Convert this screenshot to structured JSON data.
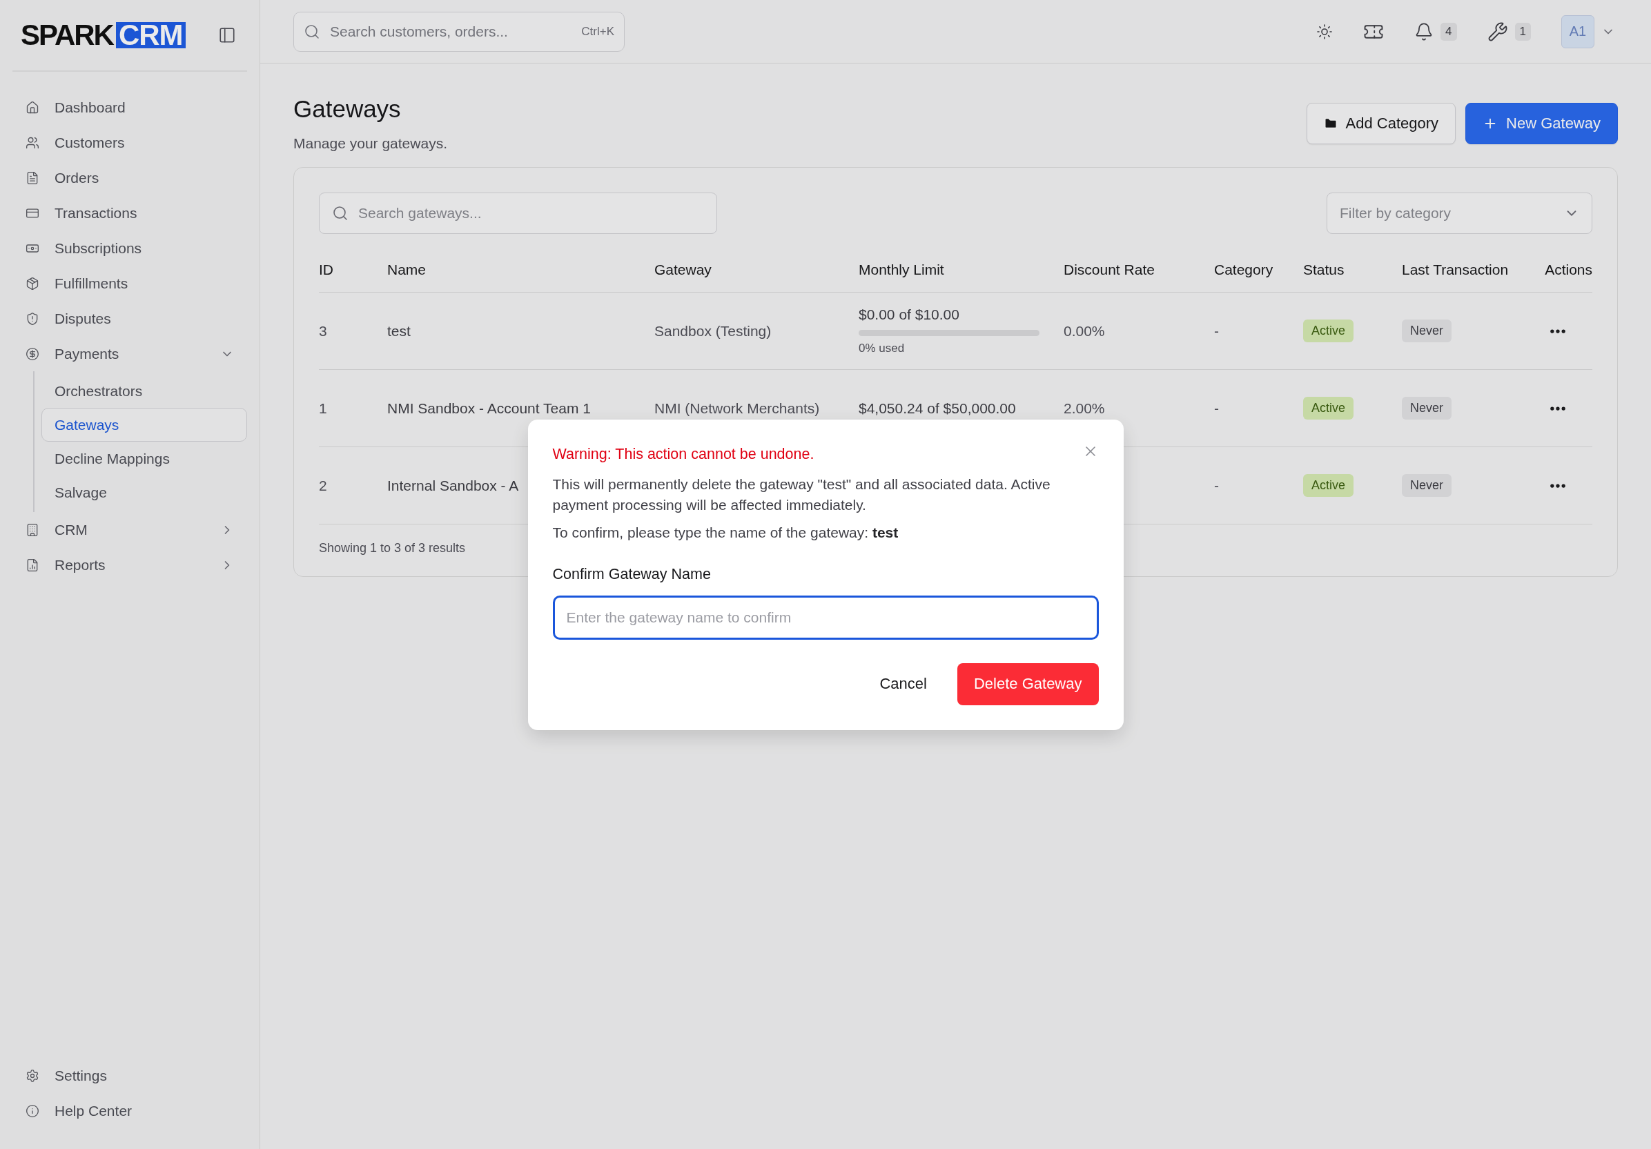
{
  "logo": {
    "text": "SPARK",
    "badge": "CRM"
  },
  "sidebar": {
    "items": [
      {
        "label": "Dashboard",
        "selected": false
      },
      {
        "label": "Customers",
        "selected": false
      },
      {
        "label": "Orders",
        "selected": false
      },
      {
        "label": "Transactions",
        "selected": false
      },
      {
        "label": "Subscriptions",
        "selected": false
      },
      {
        "label": "Fulfillments",
        "selected": false
      },
      {
        "label": "Disputes",
        "selected": false
      },
      {
        "label": "Payments",
        "selected": false,
        "expanded": true,
        "children": [
          {
            "label": "Orchestrators",
            "selected": false
          },
          {
            "label": "Gateways",
            "selected": true
          },
          {
            "label": "Decline Mappings",
            "selected": false
          },
          {
            "label": "Salvage",
            "selected": false
          }
        ]
      },
      {
        "label": "CRM",
        "selected": false,
        "expanded": false
      },
      {
        "label": "Reports",
        "selected": false,
        "expanded": false
      }
    ],
    "footer_items": [
      {
        "label": "Settings"
      },
      {
        "label": "Help Center"
      }
    ]
  },
  "topbar": {
    "search": {
      "placeholder": "Search customers, orders...",
      "shortcut": "Ctrl+K"
    },
    "notifications": "4",
    "tools": "1",
    "avatar": "A1"
  },
  "page": {
    "title": "Gateways",
    "subtitle": "Manage your gateways.",
    "buttons": [
      {
        "label": "Add Category",
        "kind": "secondary"
      },
      {
        "label": "New Gateway",
        "kind": "primary"
      }
    ]
  },
  "filters": {
    "search": {
      "placeholder": "Search gateways..."
    },
    "category": {
      "placeholder": "Filter by category"
    }
  },
  "table": {
    "columns": [
      "ID",
      "Name",
      "Gateway",
      "Monthly Limit",
      "Discount Rate",
      "Category",
      "Status",
      "Last Transaction",
      "Actions"
    ],
    "rows": [
      {
        "id": "3",
        "name": "test",
        "gateway": "Sandbox (Testing)",
        "limit": "$0.00 of $10.00",
        "level": 0,
        "usage": "0% used",
        "discount": "0.00%",
        "category": "-",
        "status": "Active",
        "last_transaction": "Never"
      },
      {
        "id": "1",
        "name": "NMI Sandbox - Account Team 1",
        "gateway": "NMI (Network Merchants)",
        "limit": "$4,050.24 of $50,000.00",
        "discount": "2.00%",
        "category": "-",
        "status": "Active",
        "last_transaction": "Never"
      },
      {
        "id": "2",
        "name": "Internal Sandbox - A",
        "category": "-",
        "status": "Active",
        "last_transaction": "Never"
      }
    ],
    "summary": "Showing 1 to 3 of 3 results"
  },
  "dialog": {
    "warning": "Warning: This action cannot be undone.",
    "message": "This will permanently delete the gateway \"test\" and all associated data. Active payment processing will be affected immediately.",
    "confirm_prompt": "To confirm, please type the name of the gateway: **test**",
    "field_label": "Confirm Gateway Name",
    "field": {
      "placeholder": "Enter the gateway name to confirm"
    },
    "buttons": [
      {
        "label": "Cancel",
        "kind": "secondary"
      },
      {
        "label": "Delete Gateway",
        "kind": "danger"
      }
    ]
  }
}
